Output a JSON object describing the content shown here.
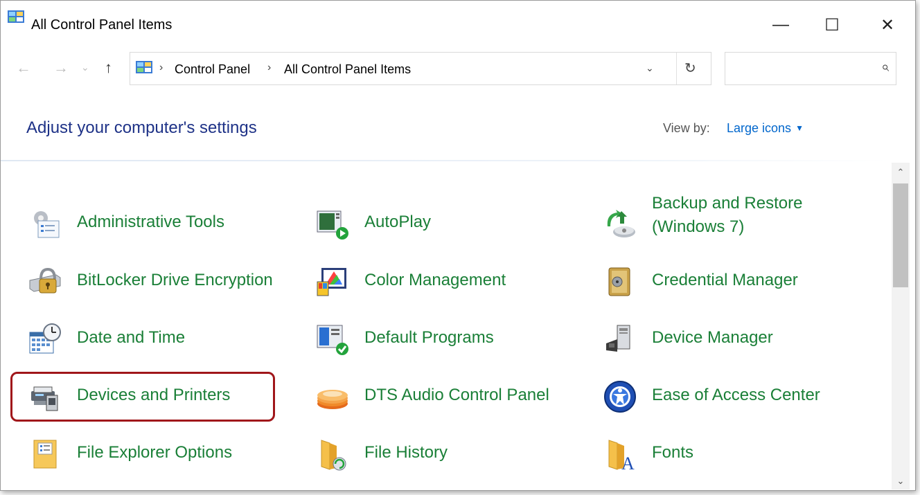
{
  "window": {
    "title": "All Control Panel Items",
    "controls": {
      "minimize": "—",
      "maximize": "☐",
      "close": "✕"
    }
  },
  "nav": {
    "back": "←",
    "forward": "→",
    "recent": "⌄",
    "up": "↑",
    "breadcrumb": [
      "Control Panel",
      "All Control Panel Items"
    ],
    "separator": "›",
    "dropdown": "⌄",
    "refresh": "↻",
    "search_placeholder": "",
    "search_icon": "⌕"
  },
  "header": {
    "title": "Adjust your computer's settings",
    "view_by_label": "View by:",
    "view_by_value": "Large icons",
    "view_by_caret": "▼"
  },
  "scrollbar": {
    "up": "⌃",
    "down": "⌄"
  },
  "items": [
    {
      "label": "Administrative Tools",
      "icon": "administrative-tools-icon"
    },
    {
      "label": "AutoPlay",
      "icon": "autoplay-icon"
    },
    {
      "label": "Backup and Restore (Windows 7)",
      "icon": "backup-restore-icon"
    },
    {
      "label": "BitLocker Drive Encryption",
      "icon": "bitlocker-icon"
    },
    {
      "label": "Color Management",
      "icon": "color-management-icon"
    },
    {
      "label": "Credential Manager",
      "icon": "credential-manager-icon"
    },
    {
      "label": "Date and Time",
      "icon": "date-time-icon"
    },
    {
      "label": "Default Programs",
      "icon": "default-programs-icon"
    },
    {
      "label": "Device Manager",
      "icon": "device-manager-icon"
    },
    {
      "label": "Devices and Printers",
      "icon": "devices-printers-icon"
    },
    {
      "label": "DTS Audio Control Panel",
      "icon": "dts-audio-icon"
    },
    {
      "label": "Ease of Access Center",
      "icon": "ease-of-access-icon"
    },
    {
      "label": "File Explorer Options",
      "icon": "file-explorer-options-icon"
    },
    {
      "label": "File History",
      "icon": "file-history-icon"
    },
    {
      "label": "Fonts",
      "icon": "fonts-icon"
    }
  ],
  "colors": {
    "link_green": "#1a7f37",
    "header_blue": "#1e3287",
    "view_blue": "#0066cc",
    "highlight": "#a0161a"
  }
}
